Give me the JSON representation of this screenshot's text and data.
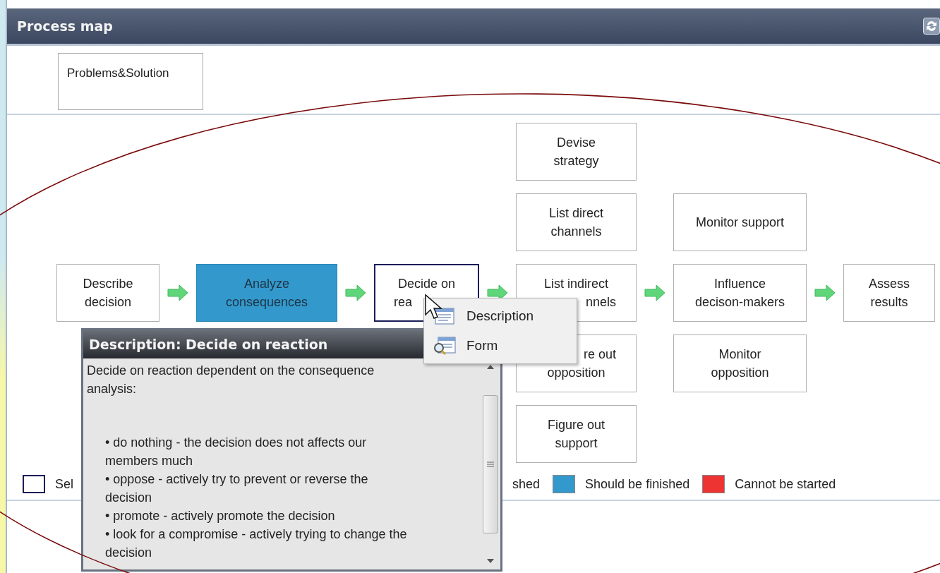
{
  "window": {
    "title": "Process map"
  },
  "top_box": {
    "label": "Problems&Solution"
  },
  "columns": [
    {
      "nodes": [
        {
          "lines": [
            {
              "text": "Describe"
            },
            {
              "text": "decision"
            }
          ],
          "should_be_finished": false,
          "selected": false
        }
      ]
    },
    {
      "nodes": [
        {
          "lines": [
            {
              "text": "Analyze"
            },
            {
              "text": "consequences"
            }
          ],
          "should_be_finished": true,
          "selected": false
        }
      ]
    },
    {
      "nodes": [
        {
          "lines": [
            {
              "text": "Decide on"
            },
            {
              "text": "rea",
              "end_covered": true
            }
          ],
          "should_be_finished": false,
          "selected": true
        }
      ]
    },
    {
      "nodes": [
        {
          "lines": [
            {
              "text": "Devise"
            },
            {
              "text": "strategy"
            }
          ],
          "should_be_finished": false,
          "selected": false
        },
        {
          "lines": [
            {
              "text": "List direct"
            },
            {
              "text": "channels"
            }
          ],
          "should_be_finished": false,
          "selected": false
        },
        {
          "lines": [
            {
              "text": "List indirect"
            },
            {
              "text": "nnels",
              "start_covered": true
            }
          ],
          "should_be_finished": false,
          "selected": false
        },
        {
          "lines": [
            {
              "text": "re out",
              "start_covered": true
            },
            {
              "text": "opposition"
            }
          ],
          "should_be_finished": false,
          "selected": false
        },
        {
          "lines": [
            {
              "text": "Figure out"
            },
            {
              "text": "support"
            }
          ],
          "should_be_finished": false,
          "selected": false
        }
      ]
    },
    {
      "nodes": [
        {
          "lines": [
            {
              "text": "Monitor support"
            }
          ],
          "should_be_finished": false,
          "selected": false
        },
        {
          "lines": [
            {
              "text": "Influence"
            },
            {
              "text": "decison-makers"
            }
          ],
          "should_be_finished": false,
          "selected": false
        },
        {
          "lines": [
            {
              "text": "Monitor"
            },
            {
              "text": "opposition"
            }
          ],
          "should_be_finished": false,
          "selected": false
        }
      ]
    },
    {
      "nodes": [
        {
          "lines": [
            {
              "text": "Assess"
            },
            {
              "text": "results"
            }
          ],
          "should_be_finished": false,
          "selected": false
        }
      ]
    }
  ],
  "legend": [
    {
      "label": "Sel",
      "color": "#ffffff"
    },
    {
      "label": "shed"
    },
    {
      "label": "Should be finished",
      "color": "#3399cc"
    },
    {
      "label": "Cannot be started",
      "color": "#ee3333"
    }
  ],
  "context_menu": {
    "items": [
      {
        "label": "Description",
        "kind": "description"
      },
      {
        "label": "Form",
        "kind": "form"
      }
    ]
  },
  "description_popup": {
    "title": "Description: Decide on reaction",
    "intro": "Decide on reaction dependent on the consequence analysis:",
    "bullets": [
      "• do nothing - the decision does not affects our members much",
      "• oppose - actively try to prevent or reverse the decision",
      "• promote - actively promote the decision",
      "• look for a compromise - actively trying to change the decision"
    ]
  }
}
